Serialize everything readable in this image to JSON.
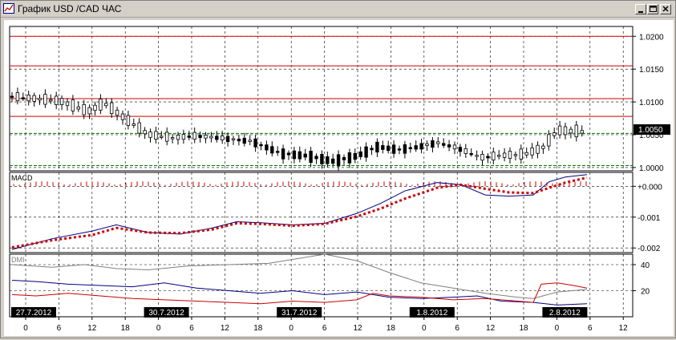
{
  "window": {
    "title": "График USD /CAD  ЧАС",
    "minimize_icon": "minimize-icon",
    "maximize_icon": "maximize-icon",
    "close_icon": "close-icon"
  },
  "colors": {
    "candle": "#000000",
    "resistance_line": "#cc0000",
    "support_line": "#008000",
    "macd_line": "#000080",
    "signal_line": "#cc0000",
    "dmi_plus": "#000080",
    "dmi_minus": "#cc0000",
    "adx": "#808080"
  },
  "chart_data": [
    {
      "type": "candlestick",
      "yaxis_ticks": [
        "1.0200",
        "1.0150",
        "1.0100",
        "1.0050",
        "1.0000"
      ],
      "current_price_label": "1.0050",
      "ylim": [
        0.9995,
        1.0215
      ],
      "horizontal_levels_red": [
        1.02,
        1.0155,
        1.0105,
        1.0078
      ],
      "horizontal_levels_green": [
        1.0052,
        1.0003
      ]
    },
    {
      "type": "line",
      "title": "MACD",
      "yaxis_ticks": [
        "+0.000",
        "-0.001",
        "-0.002"
      ],
      "ylim": [
        -0.00215,
        0.00045
      ]
    },
    {
      "type": "line",
      "title": "DMI",
      "yaxis_ticks": [
        "40",
        "20"
      ],
      "ylim": [
        0,
        48
      ]
    }
  ],
  "xaxis": {
    "hour_ticks": [
      "0",
      "6",
      "12",
      "18",
      "0",
      "6",
      "12",
      "18",
      "0",
      "6",
      "12",
      "18",
      "0",
      "6",
      "12",
      "18",
      "0",
      "6",
      "12"
    ],
    "date_labels": [
      "27.7.2012",
      "30.7.2012",
      "31.7.2012",
      "1.8.2012",
      "2.8.2012"
    ]
  }
}
